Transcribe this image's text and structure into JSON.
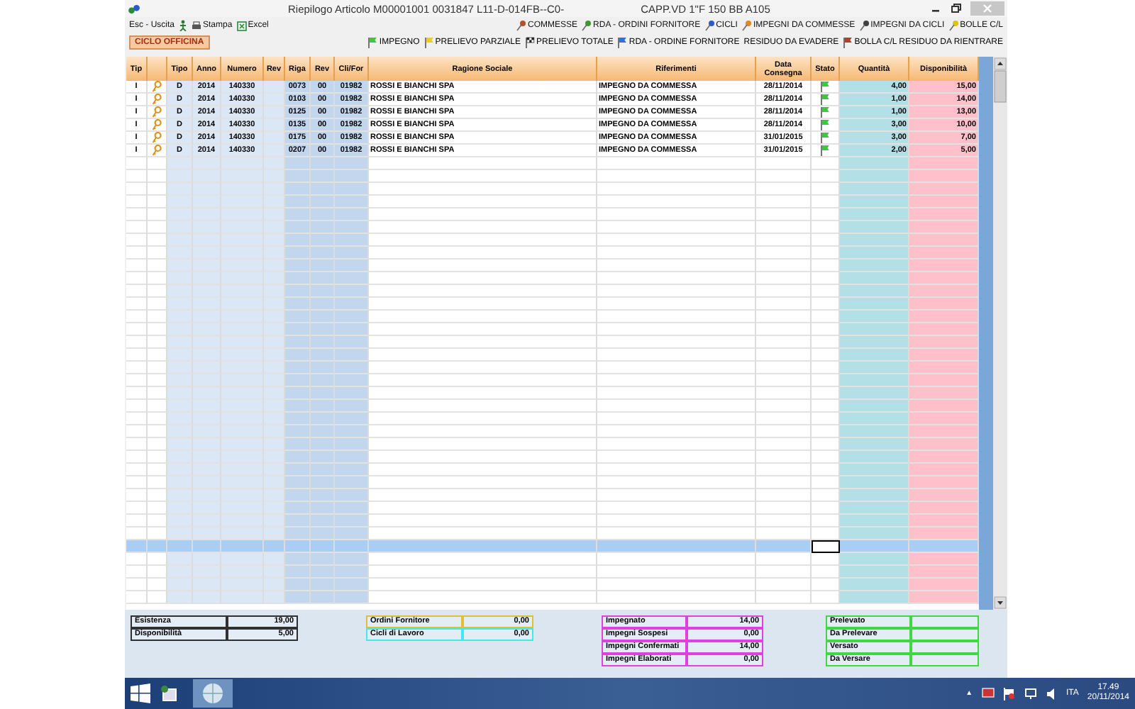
{
  "window": {
    "title": "Riepilogo Articolo M00001001 0031847 L11-D-014FB--C0-",
    "subtitle": "CAPP.VD 1\"F 150 BB A105"
  },
  "toolbar": {
    "left": [
      {
        "label": "Esc - Uscita",
        "kind": "exit"
      },
      {
        "label": "Stampa",
        "kind": "print"
      },
      {
        "label": "Excel",
        "kind": "excel"
      }
    ],
    "right": [
      {
        "label": "COMMESSE",
        "color": "#b8502a"
      },
      {
        "label": "RDA - ORDINI FORNITORE",
        "color": "#3a9a2a"
      },
      {
        "label": "CICLI",
        "color": "#2a5ac8"
      },
      {
        "label": "IMPEGNI DA COMMESSE",
        "color": "#e08a1a"
      },
      {
        "label": "IMPEGNI DA CICLI",
        "color": "#404040"
      },
      {
        "label": "BOLLE C/L",
        "color": "#e0c020"
      }
    ]
  },
  "mode_badge": "CICLO OFFICINA",
  "legend": [
    {
      "label": "IMPEGNO",
      "kind": "flag",
      "color": "#3cc83c"
    },
    {
      "label": "PRELIEVO PARZIALE",
      "kind": "flag",
      "color": "#e8d020"
    },
    {
      "label": "PRELIEVO TOTALE",
      "kind": "checkered"
    },
    {
      "label": "RDA - ORDINE FORNITORE",
      "kind": "flag",
      "color": "#3070e0"
    },
    {
      "label": "RESIDUO DA EVADERE",
      "kind": "text"
    },
    {
      "label": "BOLLA C/L RESIDUO DA RIENTRARE",
      "kind": "flag",
      "color": "#b04030"
    }
  ],
  "table": {
    "columns": [
      "Tip",
      "",
      "Tipo",
      "Anno",
      "Numero",
      "Rev",
      "Riga",
      "Rev",
      "Cli/For",
      "Ragione Sociale",
      "Riferimenti",
      "Data Consegna",
      "Stato",
      "Quantità",
      "Disponibilità"
    ],
    "rows": [
      {
        "tip": "I",
        "tipo": "D",
        "anno": "2014",
        "numero": "140330",
        "riga": "0073",
        "rev": "00",
        "clifor": "01982",
        "ragione": "ROSSI E BIANCHI SPA",
        "riferimenti": "IMPEGNO DA COMMESSA",
        "data": "28/11/2014",
        "color": "#3cc83c",
        "quantita": "4,00",
        "disponibilita": "15,00"
      },
      {
        "tip": "I",
        "tipo": "D",
        "anno": "2014",
        "numero": "140330",
        "riga": "0103",
        "rev": "00",
        "clifor": "01982",
        "ragione": "ROSSI E BIANCHI SPA",
        "riferimenti": "IMPEGNO DA COMMESSA",
        "data": "28/11/2014",
        "color": "#3cc83c",
        "quantita": "1,00",
        "disponibilita": "14,00"
      },
      {
        "tip": "I",
        "tipo": "D",
        "anno": "2014",
        "numero": "140330",
        "riga": "0125",
        "rev": "00",
        "clifor": "01982",
        "ragione": "ROSSI E BIANCHI SPA",
        "riferimenti": "IMPEGNO DA COMMESSA",
        "data": "28/11/2014",
        "color": "#3cc83c",
        "quantita": "1,00",
        "disponibilita": "13,00"
      },
      {
        "tip": "I",
        "tipo": "D",
        "anno": "2014",
        "numero": "140330",
        "riga": "0135",
        "rev": "00",
        "clifor": "01982",
        "ragione": "ROSSI E BIANCHI SPA",
        "riferimenti": "IMPEGNO DA COMMESSA",
        "data": "28/11/2014",
        "color": "#3cc83c",
        "quantita": "3,00",
        "disponibilita": "10,00"
      },
      {
        "tip": "I",
        "tipo": "D",
        "anno": "2014",
        "numero": "140330",
        "riga": "0175",
        "rev": "00",
        "clifor": "01982",
        "ragione": "ROSSI E BIANCHI SPA",
        "riferimenti": "IMPEGNO DA COMMESSA",
        "data": "31/01/2015",
        "color": "#3cc83c",
        "quantita": "3,00",
        "disponibilita": "7,00"
      },
      {
        "tip": "I",
        "tipo": "D",
        "anno": "2014",
        "numero": "140330",
        "riga": "0207",
        "rev": "00",
        "clifor": "01982",
        "ragione": "ROSSI E BIANCHI SPA",
        "riferimenti": "IMPEGNO DA COMMESSA",
        "data": "31/01/2015",
        "color": "#3cc83c",
        "quantita": "2,00",
        "disponibilita": "5,00"
      }
    ],
    "blank_rows": [
      {
        "selected": false
      },
      {
        "selected": false
      },
      {
        "selected": false
      },
      {
        "selected": false
      },
      {
        "selected": false
      },
      {
        "selected": false
      },
      {
        "selected": false
      },
      {
        "selected": false
      },
      {
        "selected": false
      },
      {
        "selected": false
      },
      {
        "selected": false
      },
      {
        "selected": false
      },
      {
        "selected": false
      },
      {
        "selected": false
      },
      {
        "selected": false
      },
      {
        "selected": false
      },
      {
        "selected": false
      },
      {
        "selected": false
      },
      {
        "selected": false
      },
      {
        "selected": false
      },
      {
        "selected": false
      },
      {
        "selected": false
      },
      {
        "selected": false
      },
      {
        "selected": false
      },
      {
        "selected": false
      },
      {
        "selected": false
      },
      {
        "selected": false
      },
      {
        "selected": false
      },
      {
        "selected": false
      },
      {
        "selected": false
      },
      {
        "selected": true
      },
      {
        "selected": false
      },
      {
        "selected": false
      },
      {
        "selected": false
      },
      {
        "selected": false
      }
    ]
  },
  "summary": [
    {
      "color": "#303030",
      "items": [
        {
          "label": "Esistenza",
          "value": "19,00"
        },
        {
          "label": "Disponibilità",
          "value": "5,00"
        }
      ]
    },
    {
      "color": "#e0c030",
      "items": [
        {
          "label": "Ordini Fornitore",
          "value": "0,00"
        }
      ]
    },
    {
      "color": "#40e8f0",
      "items": [
        {
          "label": "Cicli di Lavoro",
          "value": "0,00"
        }
      ]
    },
    {
      "color": "#e040e0",
      "items": [
        {
          "label": "Impegnato",
          "value": "14,00"
        },
        {
          "label": "Impegni Sospesi",
          "value": "0,00"
        },
        {
          "label": "Impegni Confermati",
          "value": "14,00"
        },
        {
          "label": "Impegni Elaborati",
          "value": "0,00"
        }
      ]
    },
    {
      "color": "#40d840",
      "items": [
        {
          "label": "Prelevato"
        },
        {
          "label": "Da Prelevare"
        },
        {
          "label": "Versato"
        },
        {
          "label": "Da Versare"
        }
      ]
    }
  ],
  "taskbar": {
    "tray_toggle": "▲",
    "language": "ITA",
    "time": "17.49",
    "date": "20/11/2014"
  }
}
